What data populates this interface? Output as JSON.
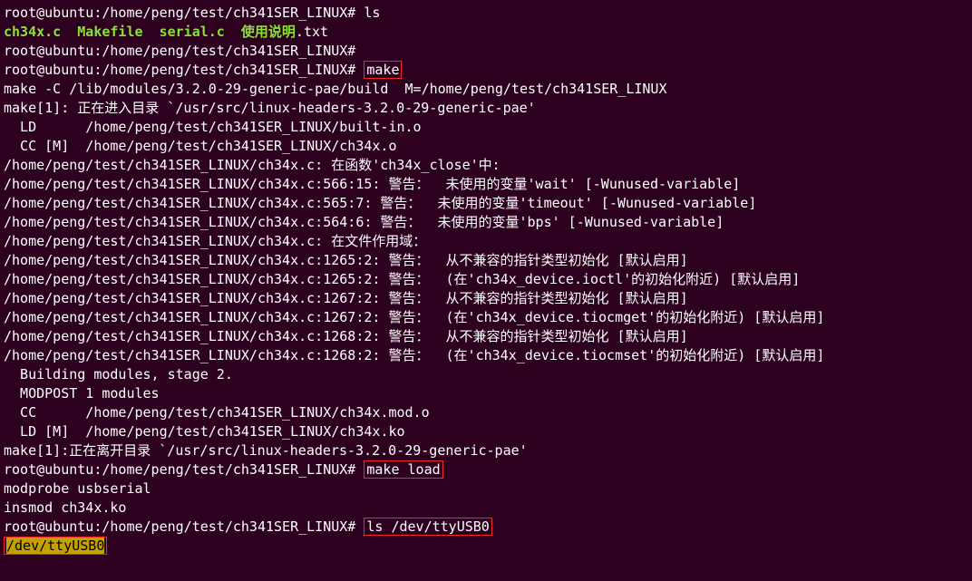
{
  "lines": [
    {
      "id": "l1",
      "prompt": "root@ubuntu:/home/peng/test/ch341SER_LINUX# ",
      "cmd": "ls"
    },
    {
      "id": "l2",
      "files": [
        [
          "green",
          "ch34x.c  "
        ],
        [
          "green",
          "Makefile  "
        ],
        [
          "green",
          "serial.c  "
        ],
        [
          "green",
          "使用说明"
        ],
        [
          "white",
          ".txt"
        ]
      ]
    },
    {
      "id": "l3",
      "prompt": "root@ubuntu:/home/peng/test/ch341SER_LINUX#"
    },
    {
      "id": "l4",
      "prompt": "root@ubuntu:/home/peng/test/ch341SER_LINUX# ",
      "cmd": "make",
      "box": true
    },
    {
      "id": "l5",
      "text": "make -C /lib/modules/3.2.0-29-generic-pae/build  M=/home/peng/test/ch341SER_LINUX"
    },
    {
      "id": "l6",
      "text": "make[1]: 正在进入目录 `/usr/src/linux-headers-3.2.0-29-generic-pae'"
    },
    {
      "id": "l7",
      "text": "  LD      /home/peng/test/ch341SER_LINUX/built-in.o"
    },
    {
      "id": "l8",
      "text": "  CC [M]  /home/peng/test/ch341SER_LINUX/ch34x.o"
    },
    {
      "id": "l9",
      "text": "/home/peng/test/ch341SER_LINUX/ch34x.c: 在函数'ch34x_close'中:"
    },
    {
      "id": "l10",
      "text": "/home/peng/test/ch341SER_LINUX/ch34x.c:566:15: 警告：  未使用的变量'wait' [-Wunused-variable]"
    },
    {
      "id": "l11",
      "text": "/home/peng/test/ch341SER_LINUX/ch34x.c:565:7: 警告：  未使用的变量'timeout' [-Wunused-variable]"
    },
    {
      "id": "l12",
      "text": "/home/peng/test/ch341SER_LINUX/ch34x.c:564:6: 警告：  未使用的变量'bps' [-Wunused-variable]"
    },
    {
      "id": "l13",
      "text": "/home/peng/test/ch341SER_LINUX/ch34x.c: 在文件作用域："
    },
    {
      "id": "l14",
      "text": "/home/peng/test/ch341SER_LINUX/ch34x.c:1265:2: 警告：  从不兼容的指针类型初始化 [默认启用]"
    },
    {
      "id": "l15",
      "text": "/home/peng/test/ch341SER_LINUX/ch34x.c:1265:2: 警告：  (在'ch34x_device.ioctl'的初始化附近) [默认启用]"
    },
    {
      "id": "l16",
      "text": "/home/peng/test/ch341SER_LINUX/ch34x.c:1267:2: 警告：  从不兼容的指针类型初始化 [默认启用]"
    },
    {
      "id": "l17",
      "text": "/home/peng/test/ch341SER_LINUX/ch34x.c:1267:2: 警告：  (在'ch34x_device.tiocmget'的初始化附近) [默认启用]"
    },
    {
      "id": "l18",
      "text": "/home/peng/test/ch341SER_LINUX/ch34x.c:1268:2: 警告：  从不兼容的指针类型初始化 [默认启用]"
    },
    {
      "id": "l19",
      "text": "/home/peng/test/ch341SER_LINUX/ch34x.c:1268:2: 警告：  (在'ch34x_device.tiocmset'的初始化附近) [默认启用]"
    },
    {
      "id": "l20",
      "text": "  Building modules, stage 2."
    },
    {
      "id": "l21",
      "text": "  MODPOST 1 modules"
    },
    {
      "id": "l22",
      "text": "  CC      /home/peng/test/ch341SER_LINUX/ch34x.mod.o"
    },
    {
      "id": "l23",
      "text": "  LD [M]  /home/peng/test/ch341SER_LINUX/ch34x.ko"
    },
    {
      "id": "l24",
      "text": "make[1]:正在离开目录 `/usr/src/linux-headers-3.2.0-29-generic-pae'"
    },
    {
      "id": "l25",
      "prompt": "root@ubuntu:/home/peng/test/ch341SER_LINUX# ",
      "cmd": "make load",
      "box": true
    },
    {
      "id": "l26",
      "text": "modprobe usbserial"
    },
    {
      "id": "l27",
      "text": "insmod ch34x.ko"
    },
    {
      "id": "l28",
      "prompt": "root@ubuntu:/home/peng/test/ch341SER_LINUX# ",
      "cmd": "ls /dev/ttyUSB0",
      "box": true
    },
    {
      "id": "l29",
      "hl": "/dev/ttyUSB0",
      "box": true
    }
  ]
}
